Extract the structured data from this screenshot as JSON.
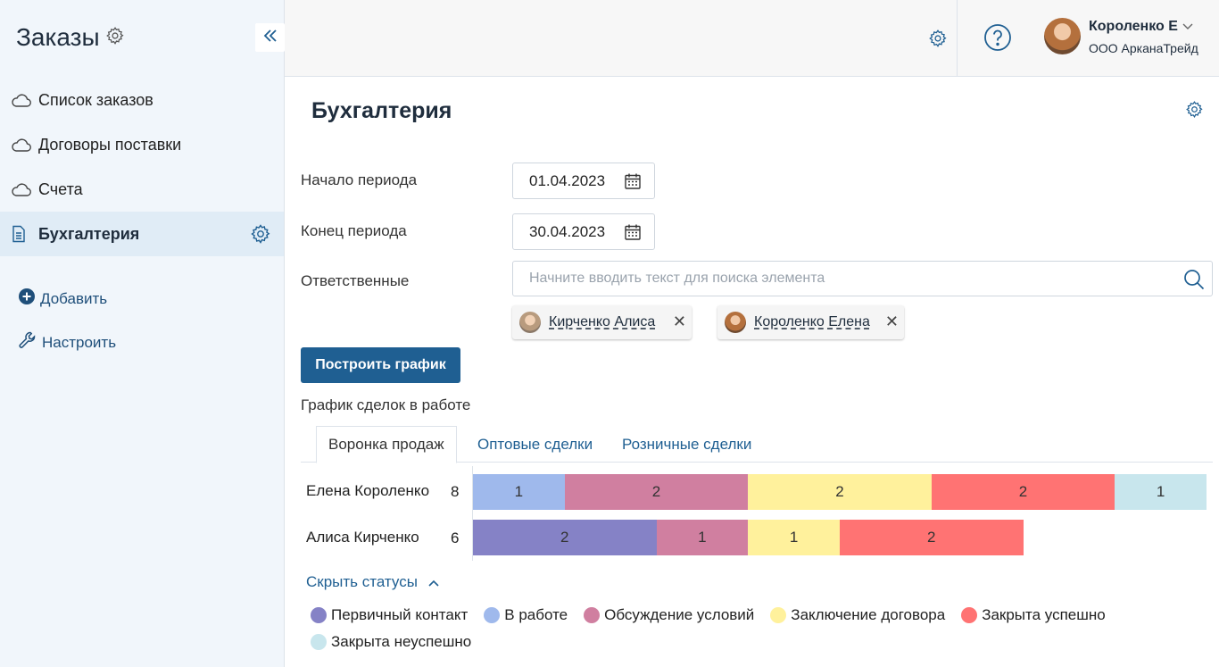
{
  "sidebar": {
    "app_title": "Заказы",
    "items": [
      {
        "label": "Список заказов",
        "icon": "cloud-icon"
      },
      {
        "label": "Договоры поставки",
        "icon": "cloud-icon"
      },
      {
        "label": "Счета",
        "icon": "cloud-icon"
      },
      {
        "label": "Бухгалтерия",
        "icon": "document-icon",
        "active": true
      }
    ],
    "add_label": "Добавить",
    "configure_label": "Настроить"
  },
  "header": {
    "user_name": "Короленко Е",
    "user_org": "ООО АрканаТрейд"
  },
  "main": {
    "title": "Бухгалтерия",
    "period_start_label": "Начало периода",
    "period_start_value": "01.04.2023",
    "period_end_label": "Конец периода",
    "period_end_value": "30.04.2023",
    "responsible_label": "Ответственные",
    "search_placeholder": "Начните вводить текст для поиска элемента",
    "chips": [
      {
        "label": "Кирченко Алиса"
      },
      {
        "label": "Короленко Елена"
      }
    ],
    "build_button": "Построить график",
    "chart_title": "График сделок в работе",
    "tabs": [
      "Воронка продаж",
      "Оптовые сделки",
      "Розничные сделки"
    ],
    "toggle_statuses": "Скрыть статусы"
  },
  "chart_data": {
    "type": "bar",
    "orientation": "horizontal-stacked",
    "categories": [
      "Елена Короленко",
      "Алиса Кирченко"
    ],
    "totals": [
      8,
      6
    ],
    "series": [
      {
        "name": "Первичный контакт",
        "color": "#8582c6",
        "values": [
          0,
          2
        ]
      },
      {
        "name": "В работе",
        "color": "#9fb9ec",
        "values": [
          1,
          0
        ]
      },
      {
        "name": "Обсуждение условий",
        "color": "#d07fa0",
        "values": [
          2,
          1
        ]
      },
      {
        "name": "Заключение договора",
        "color": "#fff19c",
        "values": [
          2,
          1
        ]
      },
      {
        "name": "Закрыта успешно",
        "color": "#ff7373",
        "values": [
          2,
          2
        ]
      },
      {
        "name": "Закрыта неуспешно",
        "color": "#c8e6ed",
        "values": [
          1,
          0
        ]
      }
    ],
    "xlim": [
      0,
      8
    ],
    "legend_position": "bottom"
  }
}
